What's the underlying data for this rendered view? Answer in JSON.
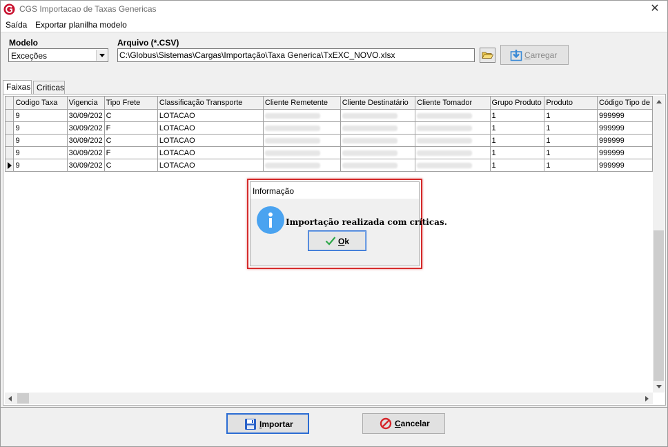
{
  "window": {
    "title": "CGS Importacao de Taxas Genericas"
  },
  "menu": {
    "items": [
      "Saída",
      "Exportar planilha modelo"
    ]
  },
  "form": {
    "modelo_label": "Modelo",
    "modelo_value": "Exceções",
    "arquivo_label": "Arquivo (*.CSV)",
    "arquivo_value": "C:\\Globus\\Sistemas\\Cargas\\Importação\\Taxa Generica\\TxEXC_NOVO.xlsx",
    "load_button": "Carregar"
  },
  "tabs": [
    "Faixas",
    "Criticas"
  ],
  "grid": {
    "columns": [
      "Codigo Taxa",
      "Vigencia",
      "Tipo Frete",
      "Classificação Transporte",
      "Cliente Remetente",
      "Cliente Destinatário",
      "Cliente Tomador",
      "Grupo Produto",
      "Produto",
      "Código Tipo de"
    ],
    "rows": [
      [
        "9",
        "30/09/202",
        "C",
        "LOTACAO",
        "",
        "",
        "",
        "1",
        "1",
        "999999"
      ],
      [
        "9",
        "30/09/202",
        "F",
        "LOTACAO",
        "",
        "",
        "",
        "1",
        "1",
        "999999"
      ],
      [
        "9",
        "30/09/202",
        "C",
        "LOTACAO",
        "",
        "",
        "",
        "1",
        "1",
        "999999"
      ],
      [
        "9",
        "30/09/202",
        "F",
        "LOTACAO",
        "",
        "",
        "",
        "1",
        "1",
        "999999"
      ],
      [
        "9",
        "30/09/202",
        "C",
        "LOTACAO",
        "",
        "",
        "",
        "1",
        "1",
        "999999"
      ]
    ]
  },
  "footer": {
    "import_button": "Importar",
    "cancel_button": "Cancelar"
  },
  "dialog": {
    "title": "Informação",
    "message": "Importação realizada com críticas.",
    "ok_button": "Ok"
  },
  "colors": {
    "accent": "#2b6cd3",
    "highlight": "#d42a2a",
    "info_icon": "#4aa3f0",
    "logo": "#c8102e"
  }
}
